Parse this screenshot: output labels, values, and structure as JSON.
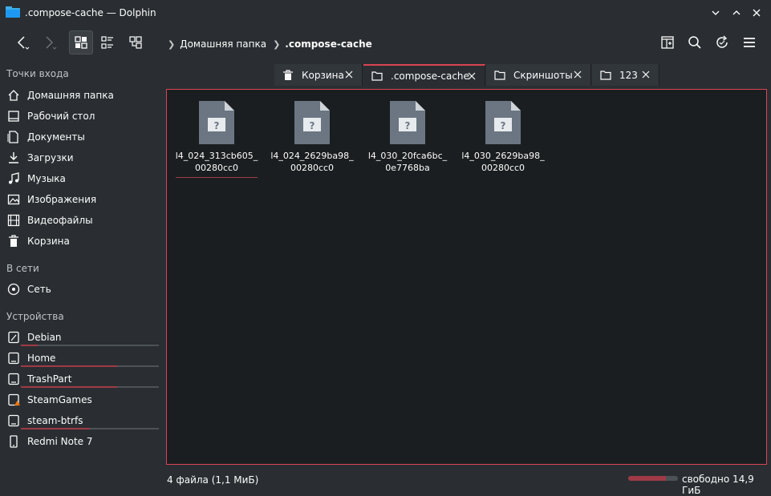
{
  "window": {
    "title": ".compose-cache — Dolphin"
  },
  "toolbar": {
    "breadcrumbs": [
      "Домашняя папка",
      ".compose-cache"
    ]
  },
  "sidebar": {
    "sections": {
      "places": "Точки входа",
      "network": "В сети",
      "devices": "Устройства"
    },
    "places": [
      {
        "label": "Домашняя папка",
        "icon": "home-icon"
      },
      {
        "label": "Рабочий стол",
        "icon": "desktop-icon"
      },
      {
        "label": "Документы",
        "icon": "documents-icon"
      },
      {
        "label": "Загрузки",
        "icon": "downloads-icon"
      },
      {
        "label": "Музыка",
        "icon": "music-icon"
      },
      {
        "label": "Изображения",
        "icon": "pictures-icon"
      },
      {
        "label": "Видеофайлы",
        "icon": "videos-icon"
      },
      {
        "label": "Корзина",
        "icon": "trash-icon"
      }
    ],
    "network": [
      {
        "label": "Сеть",
        "icon": "network-icon"
      }
    ],
    "devices": [
      {
        "label": "Debian",
        "icon": "drive-icon",
        "usage": 0.12
      },
      {
        "label": "Home",
        "icon": "drive-icon",
        "usage": 0.7
      },
      {
        "label": "TrashPart",
        "icon": "drive-icon",
        "usage": 0.7
      },
      {
        "label": "SteamGames",
        "icon": "drive-warning-icon"
      },
      {
        "label": "steam-btrfs",
        "icon": "drive-icon",
        "usage": 0.5
      },
      {
        "label": "Redmi Note 7",
        "icon": "phone-icon"
      }
    ]
  },
  "tabs": [
    {
      "label": "Корзина",
      "icon": "trash-icon",
      "active": false
    },
    {
      "label": ".compose-cache",
      "icon": "folder-icon",
      "active": true
    },
    {
      "label": "Скриншоты",
      "icon": "folder-icon",
      "active": false
    },
    {
      "label": "123",
      "icon": "folder-icon",
      "active": false
    }
  ],
  "files": [
    {
      "line1": "l4_024_313cb605_",
      "line2": "00280cc0",
      "selected": true
    },
    {
      "line1": "l4_024_2629ba98_",
      "line2": "00280cc0",
      "selected": false
    },
    {
      "line1": "l4_030_20fca6bc_",
      "line2": "0e7768ba",
      "selected": false
    },
    {
      "line1": "l4_030_2629ba98_",
      "line2": "00280cc0",
      "selected": false
    }
  ],
  "status": {
    "summary": "4 файла (1,1 МиБ)",
    "free_space": "свободно 14,9 ГиБ",
    "used_fraction": 0.75
  },
  "colors": {
    "accent": "#da4453",
    "bar": "#a03a46",
    "background": "#2a2e32",
    "view": "#1b1e20"
  }
}
